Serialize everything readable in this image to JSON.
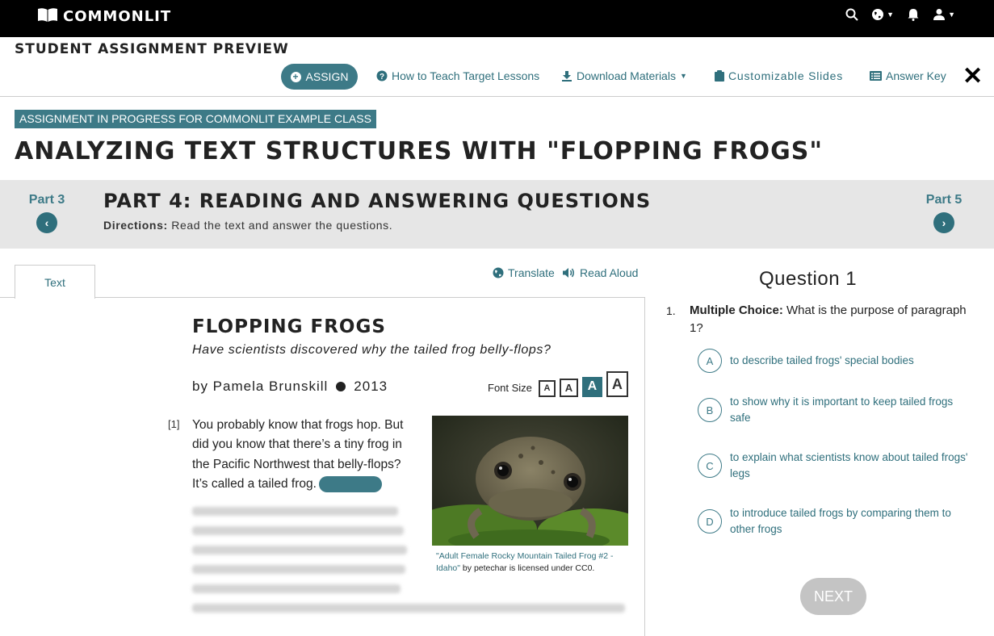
{
  "brand": {
    "name": "COMMONLIT"
  },
  "nav": {
    "icons": [
      "search-icon",
      "globe-icon",
      "bell-icon",
      "user-icon"
    ]
  },
  "preview": {
    "title": "STUDENT ASSIGNMENT PREVIEW",
    "assign_label": "ASSIGN",
    "how_to_teach": "How to Teach Target Lessons",
    "download": "Download Materials",
    "slides": "Customizable Slides",
    "answer_key": "Answer Key"
  },
  "assignment": {
    "status": "ASSIGNMENT IN PROGRESS FOR COMMONLIT EXAMPLE CLASS",
    "title": "ANALYZING TEXT STRUCTURES WITH \"FLOPPING FROGS\""
  },
  "part": {
    "prev_label": "Part 3",
    "next_label": "Part 5",
    "title": "PART 4: READING AND ANSWERING QUESTIONS",
    "directions_label": "Directions:",
    "directions_text": "Read the text and answer the questions."
  },
  "reader": {
    "tab_label": "Text",
    "translate": "Translate",
    "read_aloud": "Read Aloud",
    "story_title": "FLOPPING FROGS",
    "subtitle": "Have scientists discovered why the tailed frog belly-flops?",
    "author": "by Pamela Brunskill",
    "year": "2013",
    "font_size_label": "Font Size",
    "font_sizes": [
      "A",
      "A",
      "A",
      "A"
    ],
    "para_num": "[1]",
    "paragraph": "You probably know that frogs hop. But did you know that there’s a tiny frog in the Pacific Northwest that belly-flops? It’s called a tailed frog.",
    "caption_link": "\"Adult Female Rocky Mountain Tailed Frog #2 - Idaho\"",
    "caption_rest": " by petechar is licensed under CC0."
  },
  "question": {
    "heading": "Question 1",
    "number": "1.",
    "type_label": "Multiple Choice:",
    "prompt": " What is the purpose of paragraph 1?",
    "choices": [
      {
        "letter": "A",
        "text": "to describe tailed frogs' special bodies"
      },
      {
        "letter": "B",
        "text": "to show why it is important to keep tailed frogs safe"
      },
      {
        "letter": "C",
        "text": "to explain what scientists know about tailed frogs' legs"
      },
      {
        "letter": "D",
        "text": "to introduce tailed frogs by comparing them to other frogs"
      }
    ],
    "next_label": "NEXT"
  },
  "colors": {
    "accent": "#3d7a87",
    "topbar": "#000000",
    "partbar": "#e6e6e6"
  }
}
